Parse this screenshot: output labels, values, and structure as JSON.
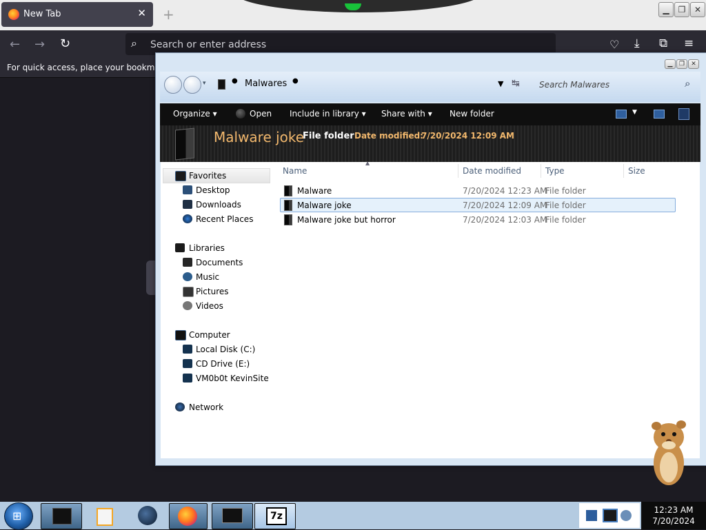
{
  "firefox": {
    "tab_title": "New Tab",
    "tab_close": "✕",
    "new_tab": "+",
    "url_placeholder": "Search or enter address",
    "bookmarks_hint": "For quick access, place your bookmarks l",
    "buttons": {
      "minimize": "▁",
      "maximize": "❐",
      "close": "✕"
    }
  },
  "explorer": {
    "breadcrumb": "Malwares",
    "search_placeholder": "Search Malwares",
    "toolbar": {
      "organize": "Organize ▾",
      "open": "Open",
      "include_library": "Include in library ▾",
      "share_with": "Share with ▾",
      "new_folder": "New folder"
    },
    "details": {
      "name": "Malware joke",
      "type": "File folder",
      "date_label": "Date modified:",
      "date_value": "7/20/2024 12:09 AM"
    },
    "nav": {
      "favorites": "Favorites",
      "desktop": "Desktop",
      "downloads": "Downloads",
      "recent": "Recent Places",
      "libraries": "Libraries",
      "documents": "Documents",
      "music": "Music",
      "pictures": "Pictures",
      "videos": "Videos",
      "computer": "Computer",
      "local_disk": "Local Disk (C:)",
      "cd_drive": "CD Drive (E:)",
      "vm": "VM0b0t KevinSite",
      "network": "Network"
    },
    "columns": {
      "name": "Name",
      "date": "Date modified",
      "type": "Type",
      "size": "Size"
    },
    "files": [
      {
        "name": "Malware",
        "date": "7/20/2024 12:23 AM",
        "type": "File folder"
      },
      {
        "name": "Malware joke",
        "date": "7/20/2024 12:09 AM",
        "type": "File folder"
      },
      {
        "name": "Malware joke but horror",
        "date": "7/20/2024 12:03 AM",
        "type": "File folder"
      }
    ]
  },
  "taskbar": {
    "time": "12:23 AM",
    "date": "7/20/2024",
    "sevenzip_label": "7z"
  },
  "colors": {
    "firefox_toolbar": "#2b2a33",
    "explorer_toolbar": "#0f0f0f",
    "details_name": "#f2b86d",
    "selection": "#cce4f7",
    "taskbar": "#b4cbe1"
  }
}
